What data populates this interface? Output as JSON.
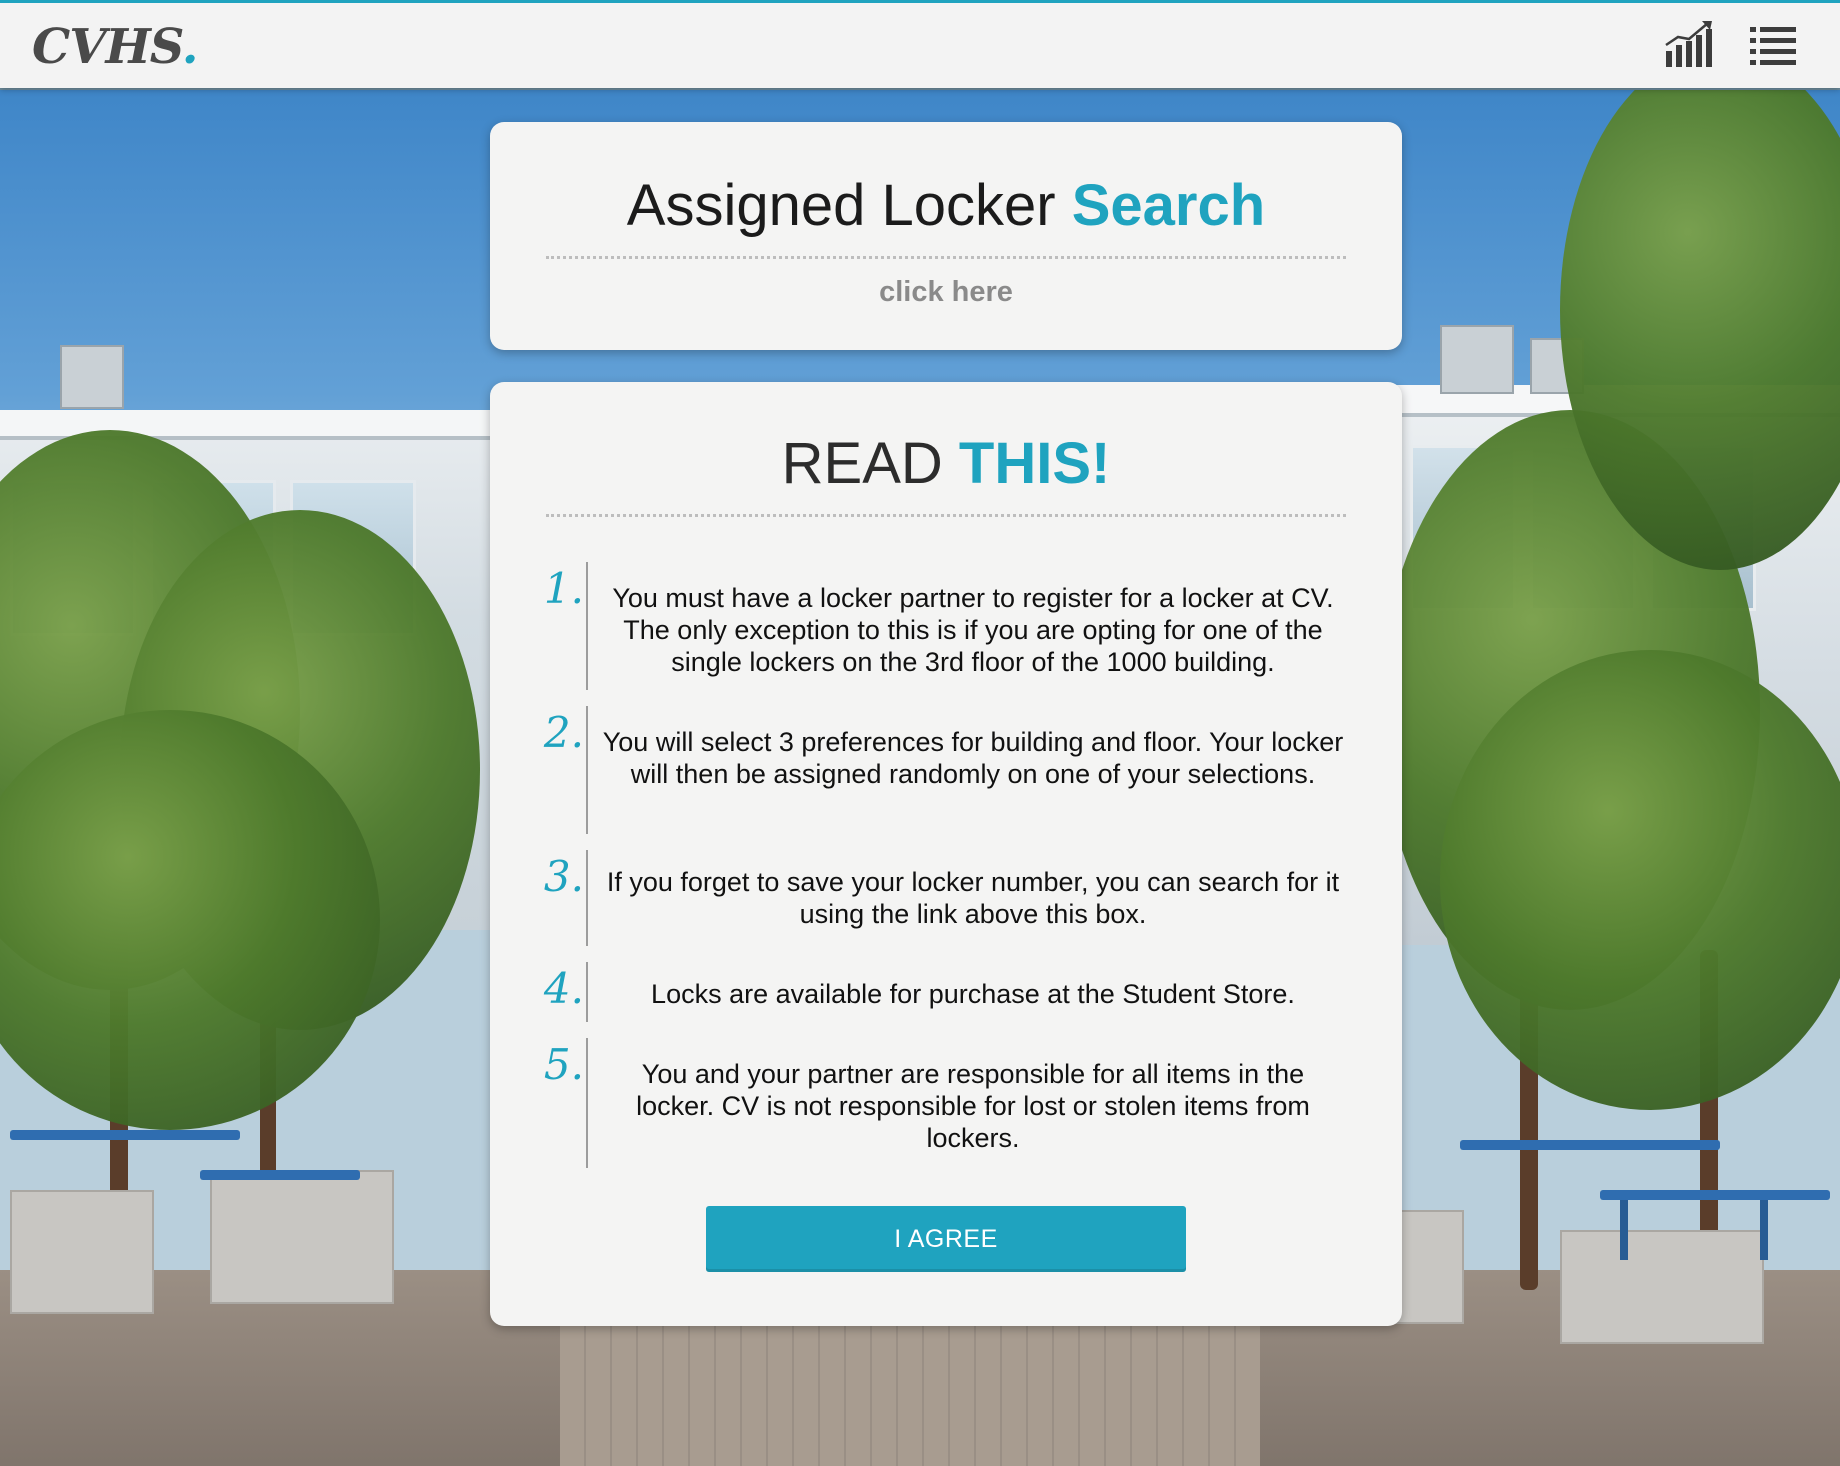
{
  "header": {
    "logo_text": "CVHS",
    "logo_dot": ".",
    "icons": [
      "stats-chart-icon",
      "list-menu-icon"
    ]
  },
  "search_card": {
    "title_main": "Assigned Locker ",
    "title_accent": "Search",
    "link_text": "click here"
  },
  "rules_card": {
    "title_main": "READ ",
    "title_accent": "THIS!",
    "rules": [
      {
        "number": "1.",
        "text": "You must have a locker partner to register for a locker at CV. The only exception to this is if you are opting for one of the single lockers on the 3rd floor of the 1000 building."
      },
      {
        "number": "2.",
        "text": "You will select 3 preferences for building and floor. Your locker will then be assigned randomly on one of your selections."
      },
      {
        "number": "3.",
        "text": "If you forget to save your locker number, you can search for it using the link above this box."
      },
      {
        "number": "4.",
        "text": "Locks are available for purchase at the Student Store."
      },
      {
        "number": "5.",
        "text": "You and your partner are responsible for all items in the locker. CV is not responsible for lost or stolen items from lockers."
      }
    ],
    "agree_label": "I AGREE"
  },
  "colors": {
    "accent": "#1fa3bf",
    "card_bg": "#f4f4f3",
    "topbar_bg": "#f3f3f3"
  }
}
